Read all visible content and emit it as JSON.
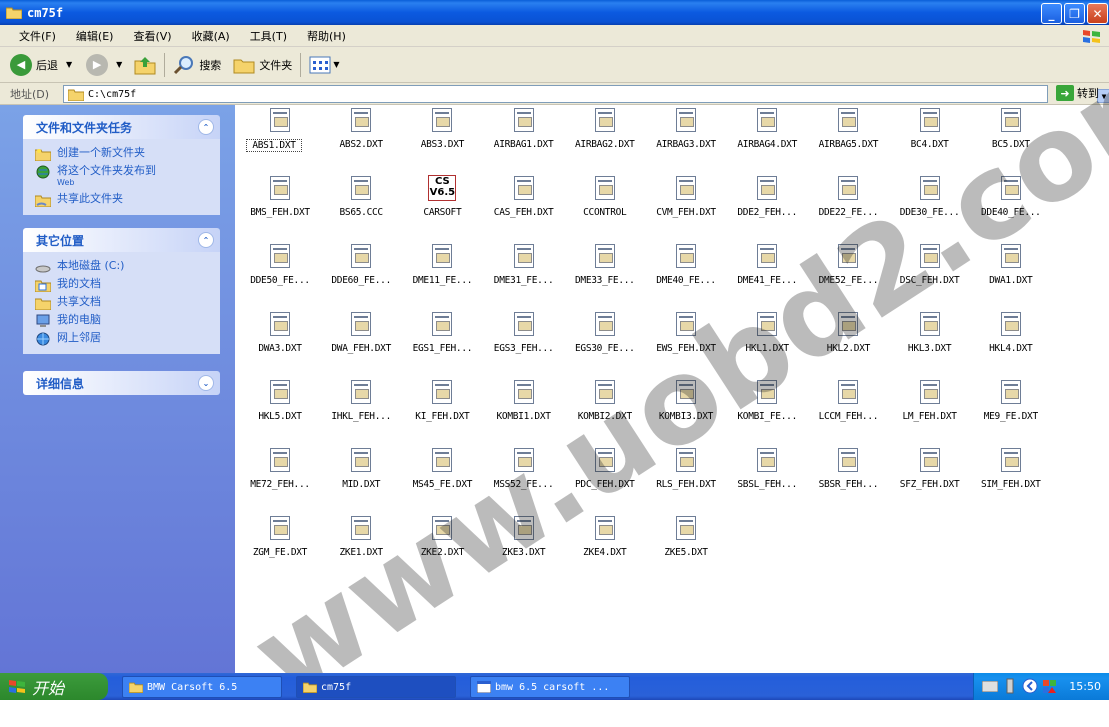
{
  "window": {
    "title": "cm75f",
    "min_symbol": "_",
    "max_symbol": "❐",
    "close_symbol": "✕"
  },
  "menu": [
    "文件(F)",
    "编辑(E)",
    "查看(V)",
    "收藏(A)",
    "工具(T)",
    "帮助(H)"
  ],
  "toolbar": {
    "back_label": "后退",
    "search_label": "搜索",
    "folders_label": "文件夹"
  },
  "address": {
    "label": "地址(D)",
    "value": "C:\\cm75f",
    "go_label": "转到"
  },
  "left": {
    "tasks": {
      "title": "文件和文件夹任务",
      "items": [
        "创建一个新文件夹",
        "将这个文件夹发布到",
        "共享此文件夹"
      ],
      "publish_sub": "Web"
    },
    "places": {
      "title": "其它位置",
      "items": [
        "本地磁盘 (C:)",
        "我的文档",
        "共享文档",
        "我的电脑",
        "网上邻居"
      ]
    },
    "details": {
      "title": "详细信息"
    }
  },
  "files": [
    "ABS1.DXT",
    "ABS2.DXT",
    "ABS3.DXT",
    "AIRBAG1.DXT",
    "AIRBAG2.DXT",
    "AIRBAG3.DXT",
    "AIRBAG4.DXT",
    "AIRBAG5.DXT",
    "BC4.DXT",
    "BC5.DXT",
    "BMS_FEH.DXT",
    "BS65.CCC",
    "CARSOFT",
    "CAS_FEH.DXT",
    "CCONTROL",
    "CVM_FEH.DXT",
    "DDE2_FEH...",
    "DDE22_FE...",
    "DDE30_FE...",
    "DDE40_FE...",
    "DDE50_FE...",
    "DDE60_FE...",
    "DME11_FE...",
    "DME31_FE...",
    "DME33_FE...",
    "DME40_FE...",
    "DME41_FE...",
    "DME52_FE...",
    "DSC_FEH.DXT",
    "DWA1.DXT",
    "DWA3.DXT",
    "DWA_FEH.DXT",
    "EGS1_FEH...",
    "EGS3_FEH...",
    "EGS30_FE...",
    "EWS_FEH.DXT",
    "HKL1.DXT",
    "HKL2.DXT",
    "HKL3.DXT",
    "HKL4.DXT",
    "HKL5.DXT",
    "IHKL_FEH...",
    "KI_FEH.DXT",
    "KOMBI1.DXT",
    "KOMBI2.DXT",
    "KOMBI3.DXT",
    "KOMBI_FE...",
    "LCCM_FEH...",
    "LM_FEH.DXT",
    "ME9_FE.DXT",
    "ME72_FEH...",
    "MID.DXT",
    "MS45_FE.DXT",
    "MSS52_FE...",
    "PDC_FEH.DXT",
    "RLS_FEH.DXT",
    "SBSL_FEH...",
    "SBSR_FEH...",
    "SFZ_FEH.DXT",
    "SIM_FEH.DXT",
    "ZGM_FE.DXT",
    "ZKE1.DXT",
    "ZKE2.DXT",
    "ZKE3.DXT",
    "ZKE4.DXT",
    "ZKE5.DXT"
  ],
  "cs_icon": {
    "line1": "CS",
    "line2": "V6.5"
  },
  "watermark": "www.uobd2.com",
  "taskbar": {
    "start_label": "开始",
    "tasks": [
      "BMW Carsoft 6.5",
      "cm75f",
      "bmw 6.5 carsoft ..."
    ],
    "clock": "15:50"
  },
  "colors": {
    "titlebar": "#0a52d4",
    "left_pane": "#6f8ee0",
    "link": "#215dc6",
    "taskbar": "#245edb",
    "start": "#2c882c"
  }
}
